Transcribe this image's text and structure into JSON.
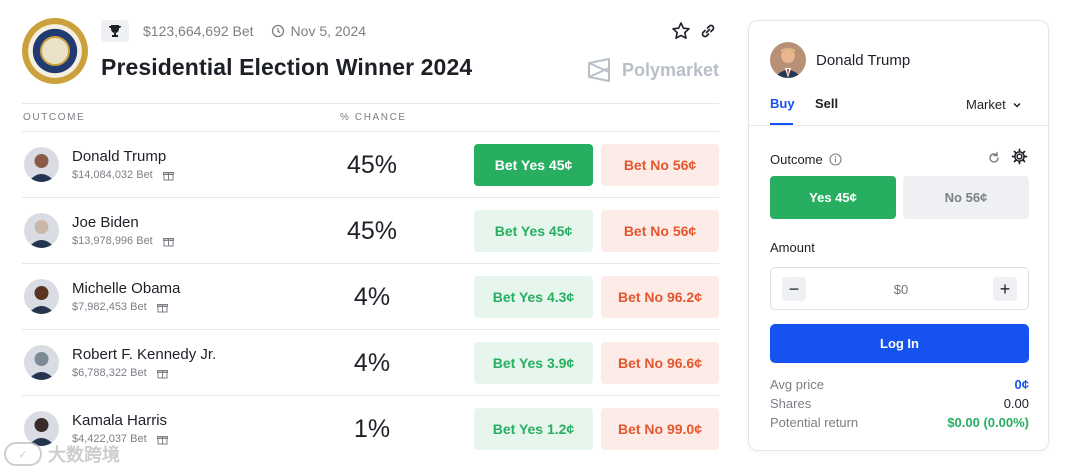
{
  "market": {
    "volume": "$123,664,692 Bet",
    "date": "Nov 5, 2024",
    "title": "Presidential Election Winner 2024",
    "brand": "Polymarket"
  },
  "table": {
    "col_outcome": "OUTCOME",
    "col_chance": "% CHANCE",
    "rows": [
      {
        "name": "Donald Trump",
        "volume": "$14,084,032 Bet",
        "chance": "45%",
        "yes": "Bet Yes 45¢",
        "no": "Bet No 56¢",
        "avatar_color": "#8a5a4a"
      },
      {
        "name": "Joe Biden",
        "volume": "$13,978,996 Bet",
        "chance": "45%",
        "yes": "Bet Yes 45¢",
        "no": "Bet No 56¢",
        "avatar_color": "#c9b8aa"
      },
      {
        "name": "Michelle Obama",
        "volume": "$7,982,453 Bet",
        "chance": "4%",
        "yes": "Bet Yes 4.3¢",
        "no": "Bet No 96.2¢",
        "avatar_color": "#5a3522"
      },
      {
        "name": "Robert F. Kennedy Jr.",
        "volume": "$6,788,322 Bet",
        "chance": "4%",
        "yes": "Bet Yes 3.9¢",
        "no": "Bet No 96.6¢",
        "avatar_color": "#7d8a96"
      },
      {
        "name": "Kamala Harris",
        "volume": "$4,422,037 Bet",
        "chance": "1%",
        "yes": "Bet Yes 1.2¢",
        "no": "Bet No 99.0¢",
        "avatar_color": "#3b2a2a"
      }
    ]
  },
  "panel": {
    "candidate": "Donald Trump",
    "tab_buy": "Buy",
    "tab_sell": "Sell",
    "order_type": "Market",
    "outcome_label": "Outcome",
    "yes_label": "Yes 45¢",
    "no_label": "No 56¢",
    "amount_label": "Amount",
    "amount_placeholder": "$0",
    "minus": "−",
    "plus": "+",
    "login_label": "Log In",
    "avg_price_label": "Avg price",
    "avg_price_value": "0¢",
    "shares_label": "Shares",
    "shares_value": "0.00",
    "return_label": "Potential return",
    "return_value": "$0.00 (0.00%)"
  },
  "watermark": "大数跨境",
  "colors": {
    "yes": "#27ae60",
    "no": "#e4572e",
    "primary": "#1652f0"
  }
}
